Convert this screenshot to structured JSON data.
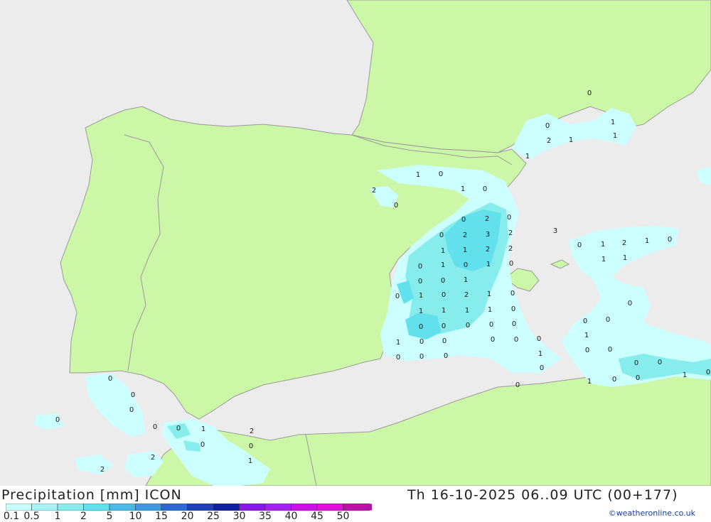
{
  "title": "Precipitation [mm] ICON",
  "datetime": "Th 16-10-2025 06..09 UTC (00+177)",
  "credit": "©weatheronline.co.uk",
  "colors": {
    "sea": "#ececec",
    "land": "#ccf7a7",
    "border": "#9a9a9a",
    "coast": "#9a9a9a"
  },
  "legend": {
    "labels": [
      "0.1",
      "0.5",
      "1",
      "2",
      "5",
      "10",
      "15",
      "20",
      "25",
      "30",
      "35",
      "40",
      "45",
      "50"
    ],
    "colors": [
      "#ccffff",
      "#a8f4f4",
      "#86ecec",
      "#62e0ec",
      "#4cbae6",
      "#3e98e2",
      "#2e68d4",
      "#2040b8",
      "#1020a0",
      "#8a18e6",
      "#a820f0",
      "#cc10e6",
      "#e010d8",
      "#bb10aa"
    ]
  },
  "map_values": [
    "0",
    "1",
    "1",
    "2",
    "1",
    "1",
    "1",
    "0",
    "0",
    "1",
    "0",
    "2",
    "0",
    "0",
    "0",
    "2",
    "3",
    "0",
    "2",
    "3",
    "2",
    "0",
    "1",
    "2",
    "1",
    "0",
    "1",
    "1",
    "2",
    "2",
    "1",
    "1",
    "0",
    "1",
    "0",
    "1",
    "0",
    "0",
    "0",
    "1",
    "0",
    "1",
    "0",
    "2",
    "1",
    "0",
    "0",
    "1",
    "1",
    "1",
    "1",
    "0",
    "0",
    "0",
    "0",
    "0",
    "0",
    "0",
    "0",
    "1",
    "1",
    "0",
    "0",
    "0",
    "0",
    "0",
    "0",
    "0",
    "1",
    "0",
    "0",
    "0",
    "0",
    "0",
    "0",
    "1",
    "0",
    "0",
    "0",
    "1",
    "0",
    "0",
    "0",
    "0",
    "0",
    "0",
    "0",
    "1",
    "2",
    "0",
    "0",
    "2",
    "1",
    "2"
  ]
}
